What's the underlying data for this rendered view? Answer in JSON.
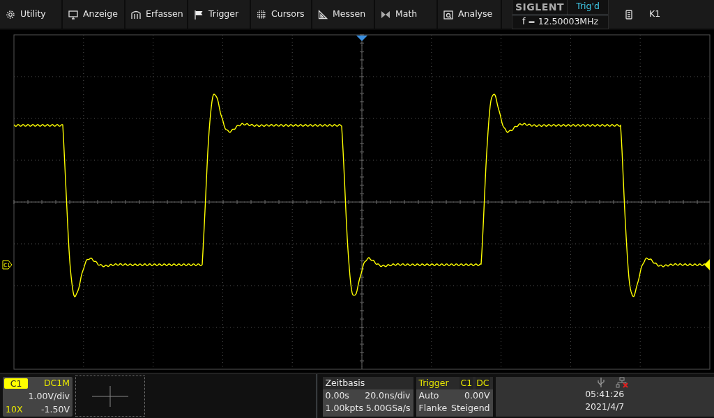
{
  "menu": [
    {
      "label": "Utility"
    },
    {
      "label": "Anzeige"
    },
    {
      "label": "Erfassen"
    },
    {
      "label": "Trigger"
    },
    {
      "label": "Cursors"
    },
    {
      "label": "Messen"
    },
    {
      "label": "Math"
    },
    {
      "label": "Analyse"
    }
  ],
  "status": {
    "brand": "SIGLENT",
    "trigger_state": "Trig'd",
    "frequency": "f = 12.50003MHz",
    "slot": "K1"
  },
  "display": {
    "channel_marker": "C1"
  },
  "channel": {
    "label": "C1",
    "coupling": "DC1M",
    "scale": "1.00V/div",
    "probe": "10X",
    "offset": "-1.50V"
  },
  "timebase": {
    "title": "Zeitbasis",
    "delay": "0.00s",
    "scale": "20.0ns/div",
    "memory": "1.00kpts",
    "rate": "5.00GSa/s"
  },
  "trigger": {
    "title": "Trigger",
    "source": "C1",
    "coupling": "DC",
    "mode": "Auto",
    "level": "0.00V",
    "type": "Flanke",
    "slope": "Steigend"
  },
  "clock": {
    "time": "05:41:26",
    "date": "2021/4/7"
  }
}
